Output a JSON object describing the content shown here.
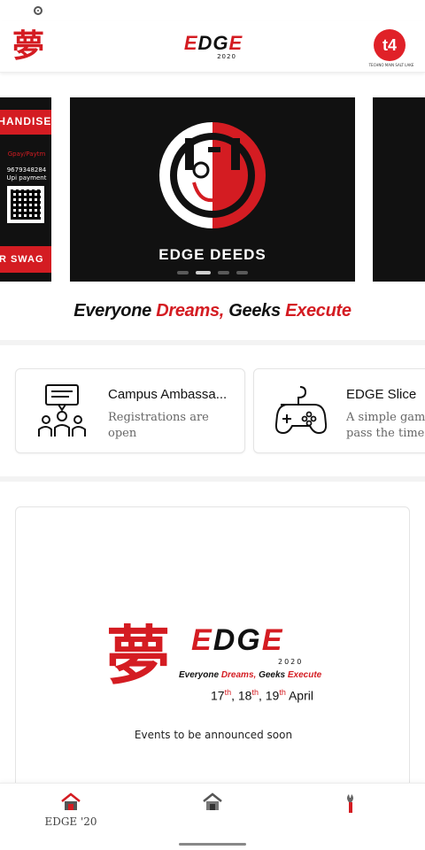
{
  "app": {
    "logo_kanji": "夢",
    "edge_word_red": "E",
    "edge_word_black": "DG",
    "edge_word_red2": "E",
    "edge_year": "2020",
    "partner_logo_text": "t4",
    "partner_caption": "TECHNO MAIN SALT LAKE"
  },
  "carousel": {
    "slides": [
      {
        "top_text": "RCHANDISE",
        "pay_text": "Gpay/Paytm",
        "phone": "9679348284",
        "upi": "Upi payment",
        "bottom_text": "UR SWAG"
      },
      {
        "title": "EDGE DEEDS"
      },
      {
        "title": ""
      }
    ],
    "active_index": 1,
    "dot_count": 4
  },
  "tagline": {
    "part1": "Everyone ",
    "part2": "Dreams, ",
    "part3": "Geeks ",
    "part4": "Execute"
  },
  "cards": [
    {
      "title": "Campus Ambassa...",
      "description": "Registrations are\nopen",
      "icon": "meeting-icon"
    },
    {
      "title": "EDGE Slice",
      "description": "A simple game\npass the time",
      "icon": "gamepad-icon"
    }
  ],
  "events": {
    "logo_kanji": "夢",
    "edge_red1": "E",
    "edge_black": "DG",
    "edge_red2": "E",
    "year": "2020",
    "tagline_k1": "Everyone ",
    "tagline_r1": "Dreams, ",
    "tagline_k2": "Geeks ",
    "tagline_r2": "Execute",
    "dates": {
      "d1": "17",
      "s1": "th",
      "d2": "18",
      "s2": "th",
      "d3": "19",
      "s3": "th",
      "month": "April"
    },
    "announcement": "Events to be announced soon"
  },
  "bottom_nav": [
    {
      "label": "EDGE '20",
      "icon": "edge-home-icon"
    },
    {
      "label": "",
      "icon": "house-icon"
    },
    {
      "label": "",
      "icon": "wrench-icon"
    }
  ],
  "colors": {
    "brand_red": "#d41c22",
    "dark": "#111111"
  }
}
